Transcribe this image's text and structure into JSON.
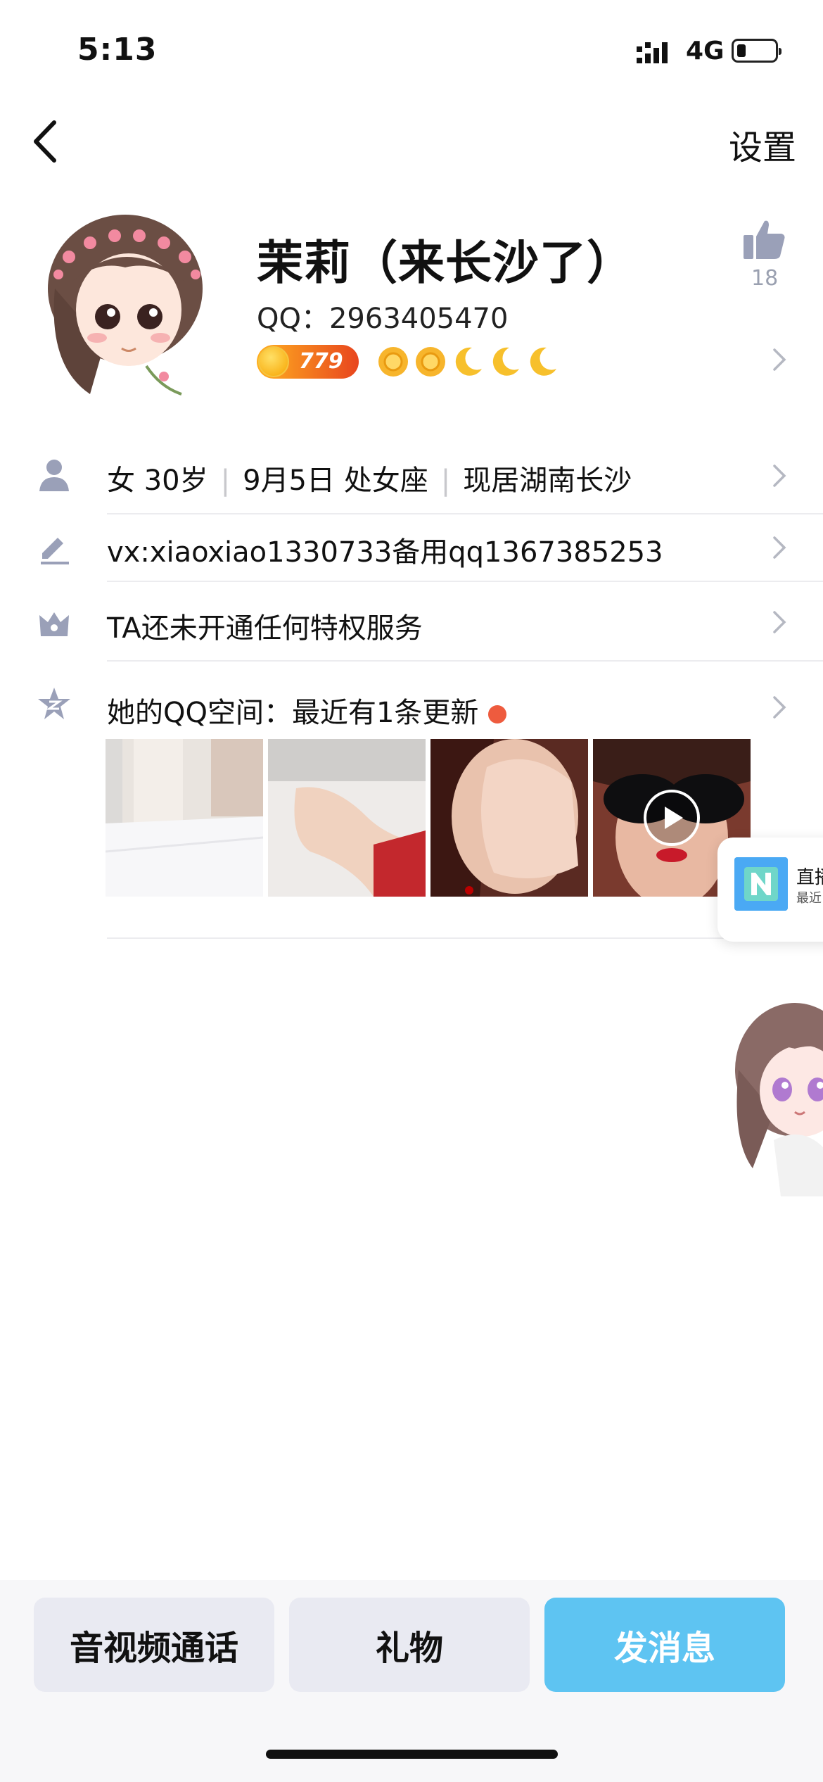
{
  "status_bar": {
    "time": "5:13",
    "network": "4G"
  },
  "nav": {
    "settings_label": "设置"
  },
  "profile": {
    "name": "茉莉（来长沙了）",
    "qq": "QQ：2963405470",
    "coin_value": "779",
    "likes": "18"
  },
  "info_rows": {
    "gender_age": "女 30岁",
    "birthday": "9月5日 处女座",
    "location": "现居湖南长沙",
    "signature": "vx:xiaoxiao1330733备用qq1367385253",
    "privilege": "TA还未开通任何特权服务",
    "qzone": "她的QQ空间：最近有1条更新"
  },
  "floating_widget": {
    "title": "直播",
    "subtitle": "最近"
  },
  "actions": {
    "call_label": "音视频通话",
    "gift_label": "礼物",
    "message_label": "发消息"
  },
  "colors": {
    "accent_blue": "#5ec4f2",
    "badge_red": "#ee5b3e",
    "icon_gray": "#9aa0b8"
  },
  "icons": [
    "back-icon",
    "like-icon",
    "person-icon",
    "edit-icon",
    "crown-icon",
    "qzone-star-icon",
    "play-icon",
    "chevron-right-icon"
  ]
}
